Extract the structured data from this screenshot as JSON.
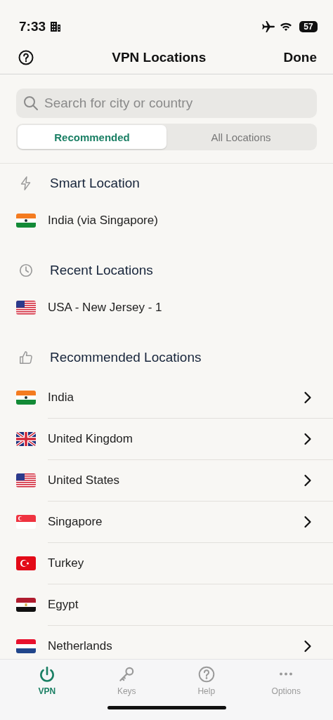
{
  "status_bar": {
    "time": "7:33",
    "battery": "57"
  },
  "nav": {
    "title": "VPN Locations",
    "done": "Done"
  },
  "search": {
    "placeholder": "Search for city or country"
  },
  "segments": [
    {
      "label": "Recommended",
      "selected": true
    },
    {
      "label": "All Locations",
      "selected": false
    }
  ],
  "sections": [
    {
      "kind": "smart",
      "title": "Smart Location",
      "items": [
        {
          "name": "India (via Singapore)",
          "kind": "in",
          "chevron": false
        }
      ]
    },
    {
      "kind": "recent",
      "title": "Recent Locations",
      "items": [
        {
          "name": "USA - New Jersey - 1",
          "kind": "us",
          "chevron": false
        }
      ]
    },
    {
      "kind": "recommended",
      "title": "Recommended Locations",
      "items": [
        {
          "name": "India",
          "kind": "in",
          "chevron": true
        },
        {
          "name": "United Kingdom",
          "kind": "gb",
          "chevron": true
        },
        {
          "name": "United States",
          "kind": "us",
          "chevron": true
        },
        {
          "name": "Singapore",
          "kind": "sg",
          "chevron": true
        },
        {
          "name": "Turkey",
          "kind": "tr",
          "chevron": false
        },
        {
          "name": "Egypt",
          "kind": "eg",
          "chevron": false
        },
        {
          "name": "Netherlands",
          "kind": "nl",
          "chevron": true
        }
      ]
    }
  ],
  "tab_bar": [
    {
      "kind": "power",
      "label": "VPN",
      "selected": true
    },
    {
      "kind": "key",
      "label": "Keys",
      "selected": false
    },
    {
      "kind": "help",
      "label": "Help",
      "selected": false
    },
    {
      "kind": "more",
      "label": "Options",
      "selected": false
    }
  ]
}
